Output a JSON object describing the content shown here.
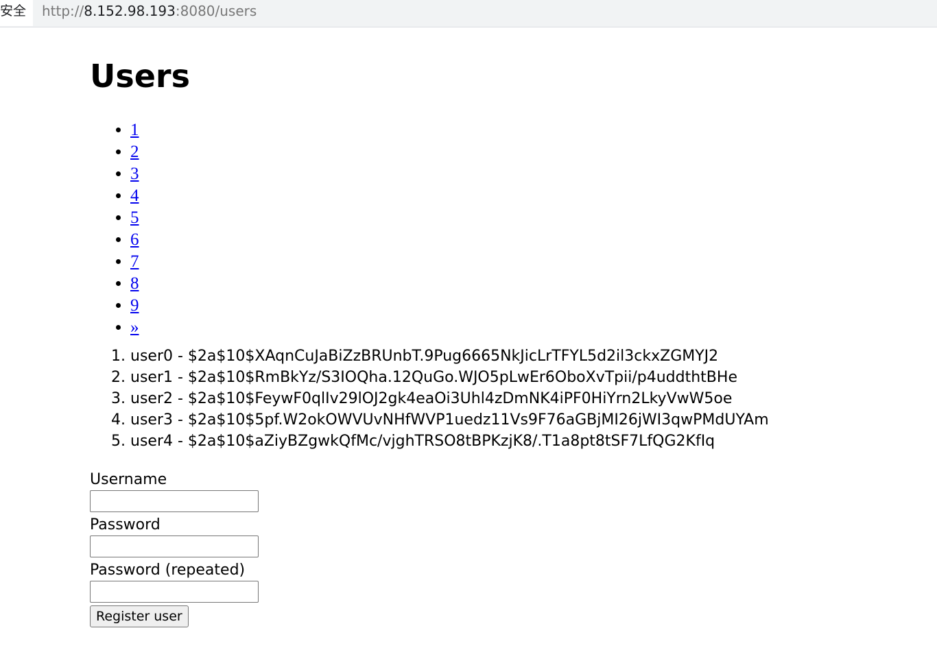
{
  "browser": {
    "security_label": "安全",
    "url_scheme": "http://",
    "url_host": "8.152.98.193",
    "url_rest": ":8080/users"
  },
  "page": {
    "title": "Users"
  },
  "pagination": [
    {
      "label": "1"
    },
    {
      "label": "2"
    },
    {
      "label": "3"
    },
    {
      "label": "4"
    },
    {
      "label": "5"
    },
    {
      "label": "6"
    },
    {
      "label": "7"
    },
    {
      "label": "8"
    },
    {
      "label": "9"
    },
    {
      "label": "»"
    }
  ],
  "users": [
    {
      "text": "user0 - $2a$10$XAqnCuJaBiZzBRUnbT.9Pug6665NkJicLrTFYL5d2il3ckxZGMYJ2"
    },
    {
      "text": "user1 - $2a$10$RmBkYz/S3IOQha.12QuGo.WJO5pLwEr6OboXvTpii/p4uddthtBHe"
    },
    {
      "text": "user2 - $2a$10$FeywF0qlIv29lOJ2gk4eaOi3Uhl4zDmNK4iPF0HiYrn2LkyVwW5oe"
    },
    {
      "text": "user3 - $2a$10$5pf.W2okOWVUvNHfWVP1uedz11Vs9F76aGBjMI26jWI3qwPMdUYAm"
    },
    {
      "text": "user4 - $2a$10$aZiyBZgwkQfMc/vjghTRSO8tBPKzjK8/.T1a8pt8tSF7LfQG2KfIq"
    }
  ],
  "form": {
    "username_label": "Username",
    "username_value": "",
    "password_label": "Password",
    "password_value": "",
    "password_repeat_label": "Password (repeated)",
    "password_repeat_value": "",
    "submit_label": "Register user"
  }
}
